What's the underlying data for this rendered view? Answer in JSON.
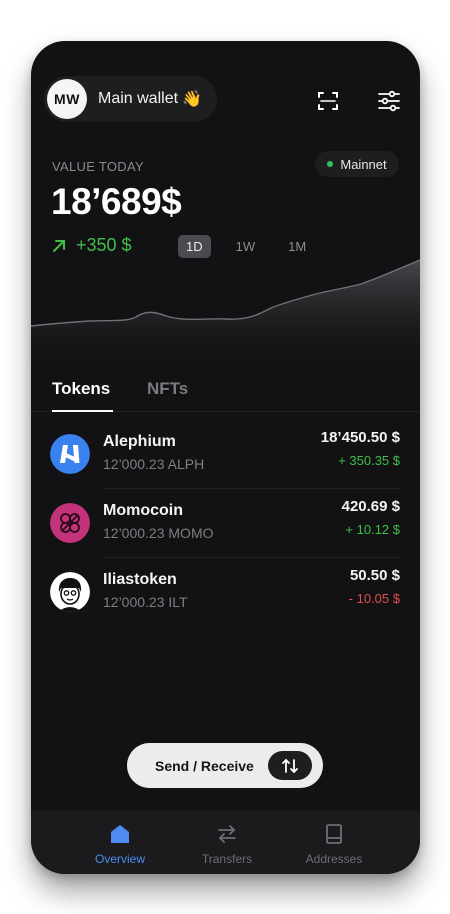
{
  "header": {
    "avatar_initials": "MW",
    "wallet_name": "Main wallet",
    "wallet_emoji": "👋"
  },
  "summary": {
    "value_label": "VALUE TODAY",
    "network": "Mainnet",
    "value": "18’689$",
    "change": "+350 $",
    "ranges": [
      "1D",
      "1W",
      "1M"
    ],
    "selected_range": "1D"
  },
  "tabs": {
    "tokens": "Tokens",
    "nfts": "NFTs"
  },
  "tokens": [
    {
      "name": "Alephium",
      "balance": "12’000.23 ALPH",
      "value": "18’450.50 $",
      "change": "+ 350.35 $"
    },
    {
      "name": "Momocoin",
      "balance": "12’000.23 MOMO",
      "value": "420.69 $",
      "change": "+ 10.12 $"
    },
    {
      "name": "Iliastoken",
      "balance": "12’000.23 ILT",
      "value": "50.50 $",
      "change": "- 10.05 $"
    }
  ],
  "actions": {
    "send_receive": "Send / Receive"
  },
  "nav": {
    "overview": "Overview",
    "transfers": "Transfers",
    "addresses": "Addresses"
  },
  "colors": {
    "background": "#121214",
    "positive": "#3fbf48",
    "negative": "#e05050",
    "accent": "#4e8bf0",
    "network_dot": "#2ec45a",
    "alephium_brand": "#3a82f0",
    "momocoin_brand": "#c2337a"
  },
  "icons": {
    "scan": "scan-icon",
    "settings": "sliders-icon",
    "change": "arrow-up-right-icon",
    "send_receive": "swap-vertical-icon",
    "overview": "home-icon",
    "transfers": "transfer-arrows-icon",
    "addresses": "book-icon"
  }
}
